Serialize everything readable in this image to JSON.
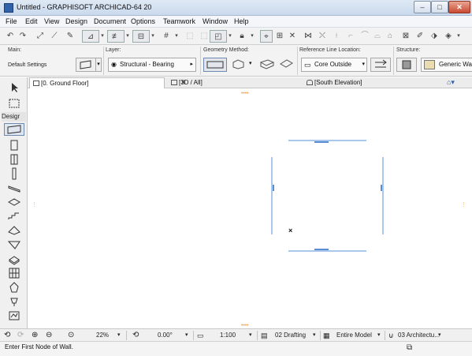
{
  "window": {
    "title": "Untitled - GRAPHISOFT ARCHICAD-64 20",
    "minimize": "–",
    "maximize": "□",
    "close": "✕"
  },
  "menu": [
    "File",
    "Edit",
    "View",
    "Design",
    "Document",
    "Options",
    "Teamwork",
    "Window",
    "Help"
  ],
  "infobox": {
    "main_label": "Main:",
    "default_settings": "Default Settings",
    "layer_label": "Layer:",
    "layer_value": "Structural - Bearing",
    "geometry_label": "Geometry Method:",
    "reference_label": "Reference Line Location:",
    "reference_value": "Core Outside",
    "structure_label": "Structure:",
    "structure_value": "Generic Wa"
  },
  "tabs": [
    {
      "label": "[0. Ground Floor]",
      "close": "×"
    },
    {
      "label": "[3D / All]"
    },
    {
      "label": "[South Elevation]"
    }
  ],
  "toolbox": {
    "palette_label": "Desigr"
  },
  "canvas": {
    "cursor_mark": "×"
  },
  "status": {
    "zoom": "22%",
    "angle": "0.00°",
    "scale": "1:100",
    "layer_combo": "02 Drafting",
    "model_view": "Entire Model",
    "pen_set": "03 Architectu..."
  },
  "prompt": "Enter First Node of Wall.",
  "colors": {
    "accent": "#2f62a8",
    "canvas_lines": "#5a8fd8",
    "grip": "#f2a24c"
  }
}
